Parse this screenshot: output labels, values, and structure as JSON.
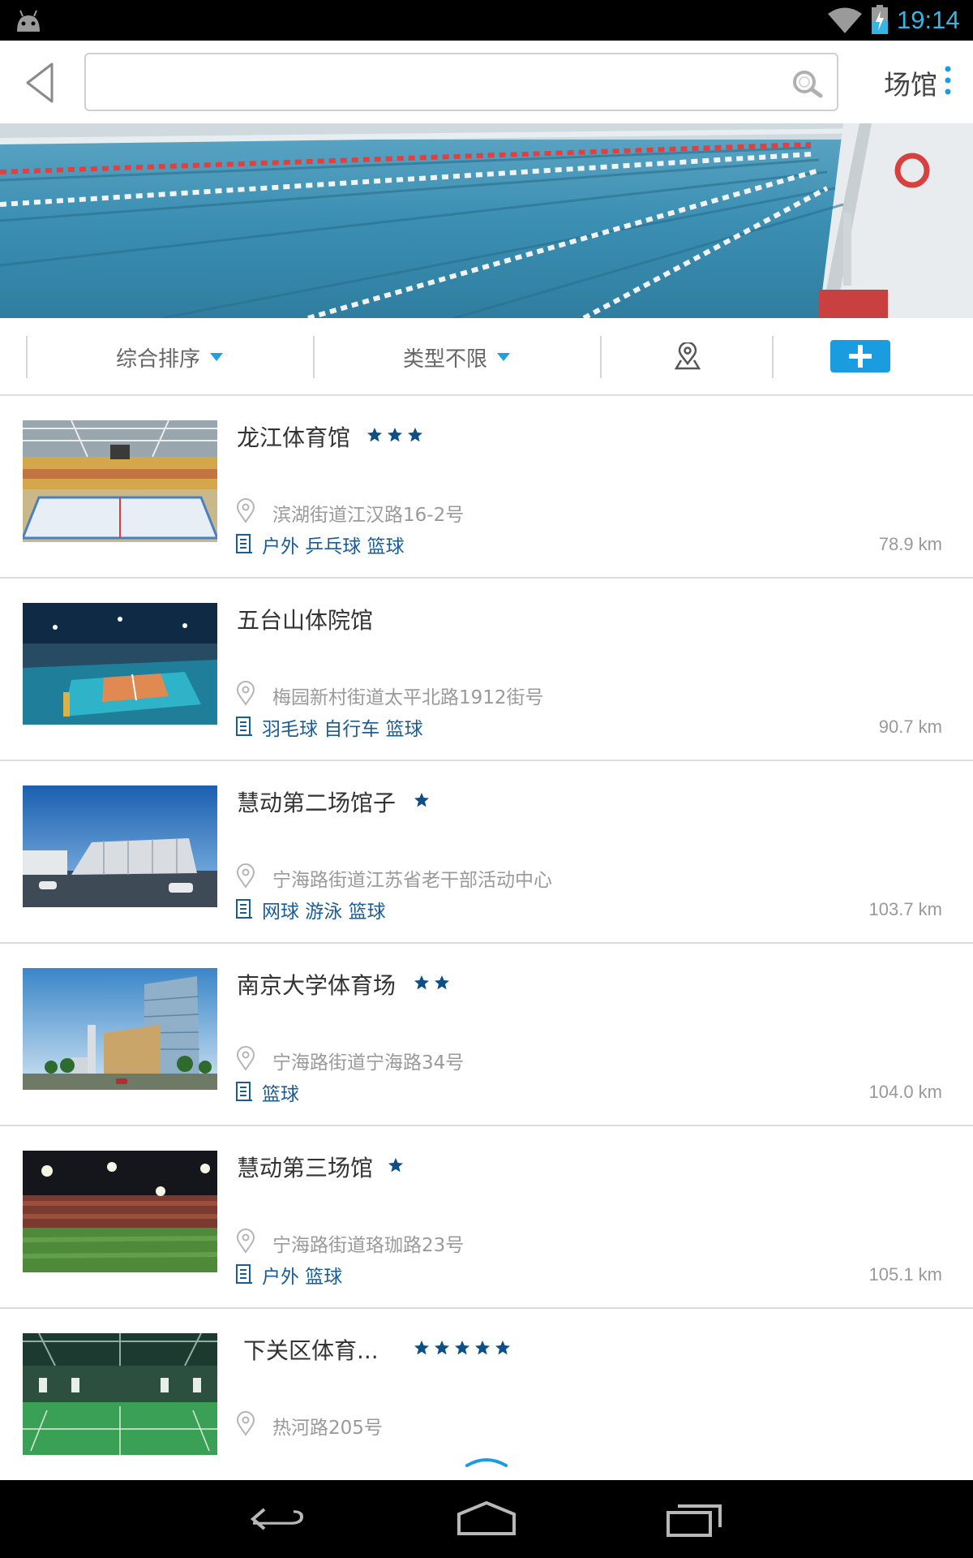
{
  "status_bar": {
    "time": "19:14",
    "icons": [
      "android-icon",
      "wifi-icon",
      "battery-charging-icon"
    ]
  },
  "header": {
    "back_icon": "back-arrow-icon",
    "search": {
      "value": "",
      "placeholder": "",
      "icon": "search-icon"
    },
    "title": "场馆",
    "menu_icon": "overflow-menu-icon"
  },
  "banner": {
    "description_icon": "swimming-pool-banner"
  },
  "filters": {
    "sort": {
      "label": "综合排序"
    },
    "type": {
      "label": "类型不限"
    },
    "map_icon": "map-pin-icon",
    "add_icon": "plus-icon"
  },
  "venues": [
    {
      "name": "龙江体育馆",
      "rating": 3,
      "address": "滨湖街道江汉路16-2号",
      "tags": "户外 乒乓球 篮球",
      "distance": "78.9 km",
      "thumb": "indoor-ice-arena"
    },
    {
      "name": "五台山体院馆",
      "rating": 0,
      "address": "梅园新村街道太平北路1912街号",
      "tags": "羽毛球 自行车 篮球",
      "distance": "90.7 km",
      "thumb": "indoor-volleyball-hall"
    },
    {
      "name": "慧动第二场馆子",
      "rating": 1,
      "address": "宁海路街道江苏省老干部活动中心",
      "tags": "网球 游泳 篮球",
      "distance": "103.7 km",
      "thumb": "modern-building-exterior"
    },
    {
      "name": "南京大学体育场",
      "rating": 2,
      "address": "宁海路街道宁海路34号",
      "tags": "篮球",
      "distance": "104.0 km",
      "thumb": "glass-tower-exterior"
    },
    {
      "name": "慧动第三场馆",
      "rating": 1,
      "address": "宁海路街道珞珈路23号",
      "tags": "户外 篮球",
      "distance": "105.1 km",
      "thumb": "night-football-stadium"
    },
    {
      "name": "下关区体育...",
      "rating": 5,
      "address": "热河路205号",
      "tags": "",
      "distance": "",
      "thumb": "badminton-hall"
    }
  ],
  "colors": {
    "accent": "#1a9de0",
    "star": "#0d4f86",
    "tag_text": "#1a5c96",
    "status_time": "#33b5e5"
  },
  "nav_bar": {
    "icons": [
      "nav-back-icon",
      "nav-home-icon",
      "nav-recent-apps-icon"
    ]
  }
}
